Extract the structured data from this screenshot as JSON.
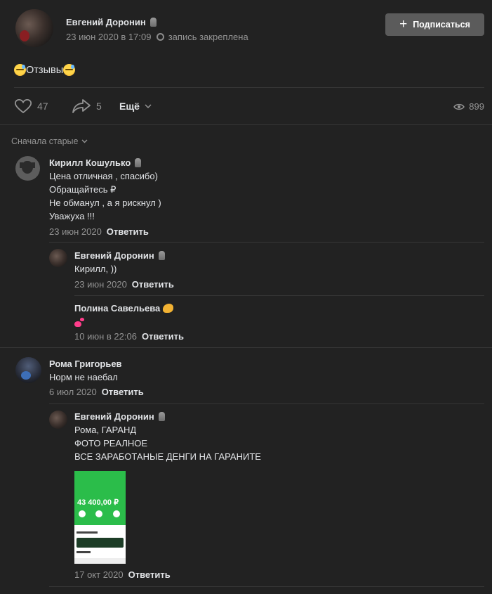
{
  "post": {
    "author": "Евгений Доронин",
    "date": "23 июн 2020 в 17:09",
    "pinned": "запись закреплена",
    "subscribe_label": "Подписаться",
    "text": "Отзывы",
    "likes": "47",
    "shares": "5",
    "more_label": "Ещё",
    "views": "899"
  },
  "sort_label": "Сначала старые",
  "reply_label": "Ответить",
  "comments": [
    {
      "author": "Кирилл Кошулько",
      "lines": [
        "Цена отличная , спасибо)",
        "Обращайтесь ₽",
        "Не обманул , а я рискнул )",
        "Уважуха !!!"
      ],
      "date": "23 июн 2020"
    },
    {
      "author": "Евгений Доронин",
      "lines": [
        "Кирилл, ))"
      ],
      "date": "23 июн 2020"
    },
    {
      "author": "Полина Савельева",
      "date": "10 июн в 22:06"
    },
    {
      "author": "Рома Григорьев",
      "lines": [
        "Норм не наебал"
      ],
      "date": "6 июл 2020"
    },
    {
      "author": "Евгений Доронин",
      "lines": [
        "Рома, ГАРАНД",
        "ФОТО РЕАЛНОЕ",
        "ВСЕ ЗАРАБОТАНЫЕ ДЕНГИ НА ГАРАНИТЕ"
      ],
      "date": "17 окт 2020",
      "attachment_amount": "43 400,00 ₽"
    }
  ]
}
